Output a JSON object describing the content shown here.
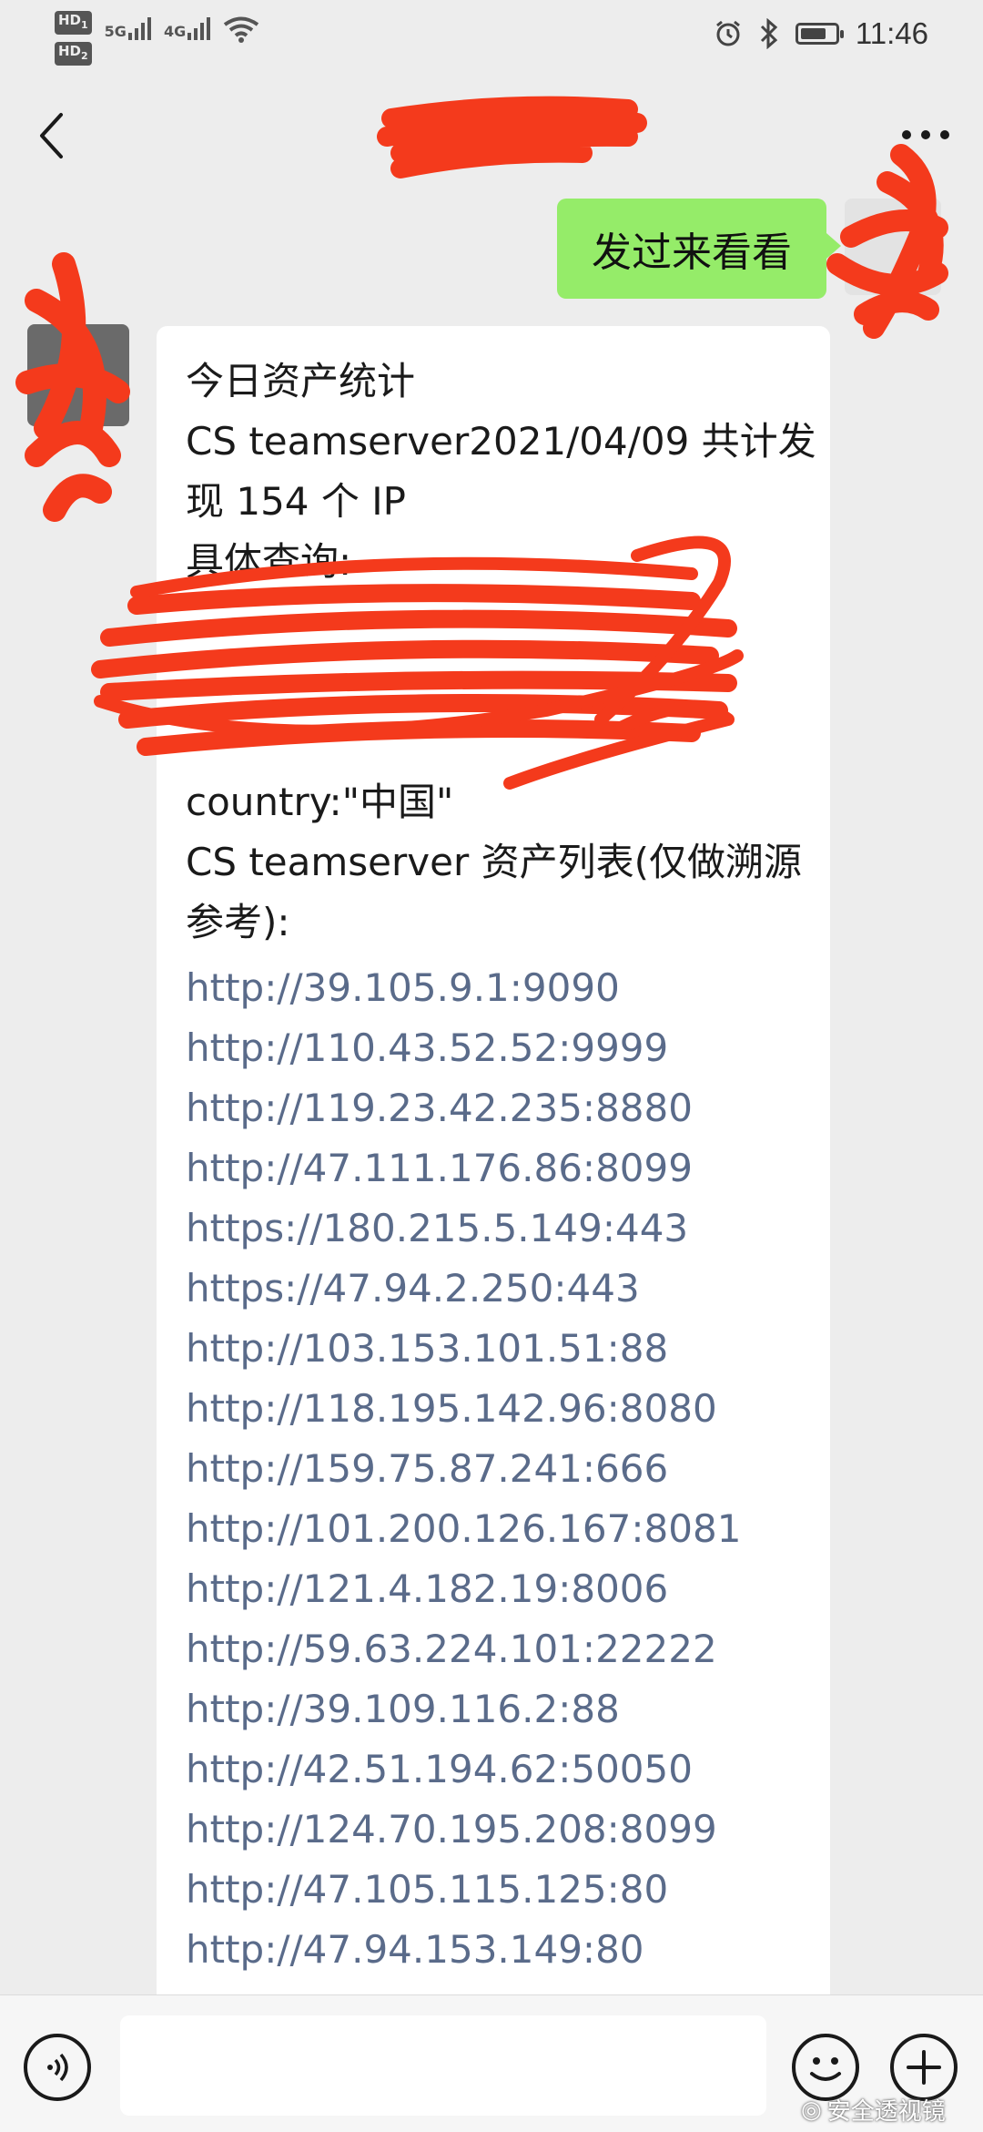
{
  "status_bar": {
    "hd1": "HD",
    "hd1_sub": "1",
    "hd2": "HD",
    "hd2_sub": "2",
    "net1": "5G",
    "net2": "4G",
    "time": "11:46",
    "battery_level": 0.75,
    "icons": [
      "alarm-icon",
      "bluetooth-icon",
      "battery-icon",
      "wifi-icon",
      "signal-icon"
    ]
  },
  "header": {
    "back_icon": "chevron-left-icon",
    "more_icon": "more-dots-icon"
  },
  "outgoing_message": {
    "text": "发过来看看"
  },
  "incoming_message": {
    "lines": [
      "今日资产统计",
      "CS teamserver2021/04/09 共计发",
      "现 154 个 IP",
      "具体查询:",
      "country:\"中国\"",
      "CS teamserver 资产列表(仅做溯源",
      "参考):"
    ],
    "links": [
      "http://39.105.9.1:9090",
      "http://110.43.52.52:9999",
      "http://119.23.42.235:8880",
      "http://47.111.176.86:8099",
      "https://180.215.5.149:443",
      "https://47.94.2.250:443",
      "http://103.153.101.51:88",
      "http://118.195.142.96:8080",
      "http://159.75.87.241:666",
      "http://101.200.126.167:8081",
      "http://121.4.182.19:8006",
      "http://59.63.224.101:22222",
      "http://39.109.116.2:88",
      "http://42.51.194.62:50050",
      "http://124.70.195.208:8099",
      "http://47.105.115.125:80",
      "http://47.94.153.149:80"
    ]
  },
  "input_bar": {
    "voice_icon": "voice-icon",
    "emoji_icon": "emoji-icon",
    "plus_icon": "plus-icon"
  },
  "watermark": {
    "text": "安全透视镜"
  },
  "colors": {
    "background": "#ededed",
    "outgoing_bubble": "#95ec69",
    "incoming_bubble": "#ffffff",
    "link": "#5a6b8a",
    "scribble": "#f43a1c"
  }
}
